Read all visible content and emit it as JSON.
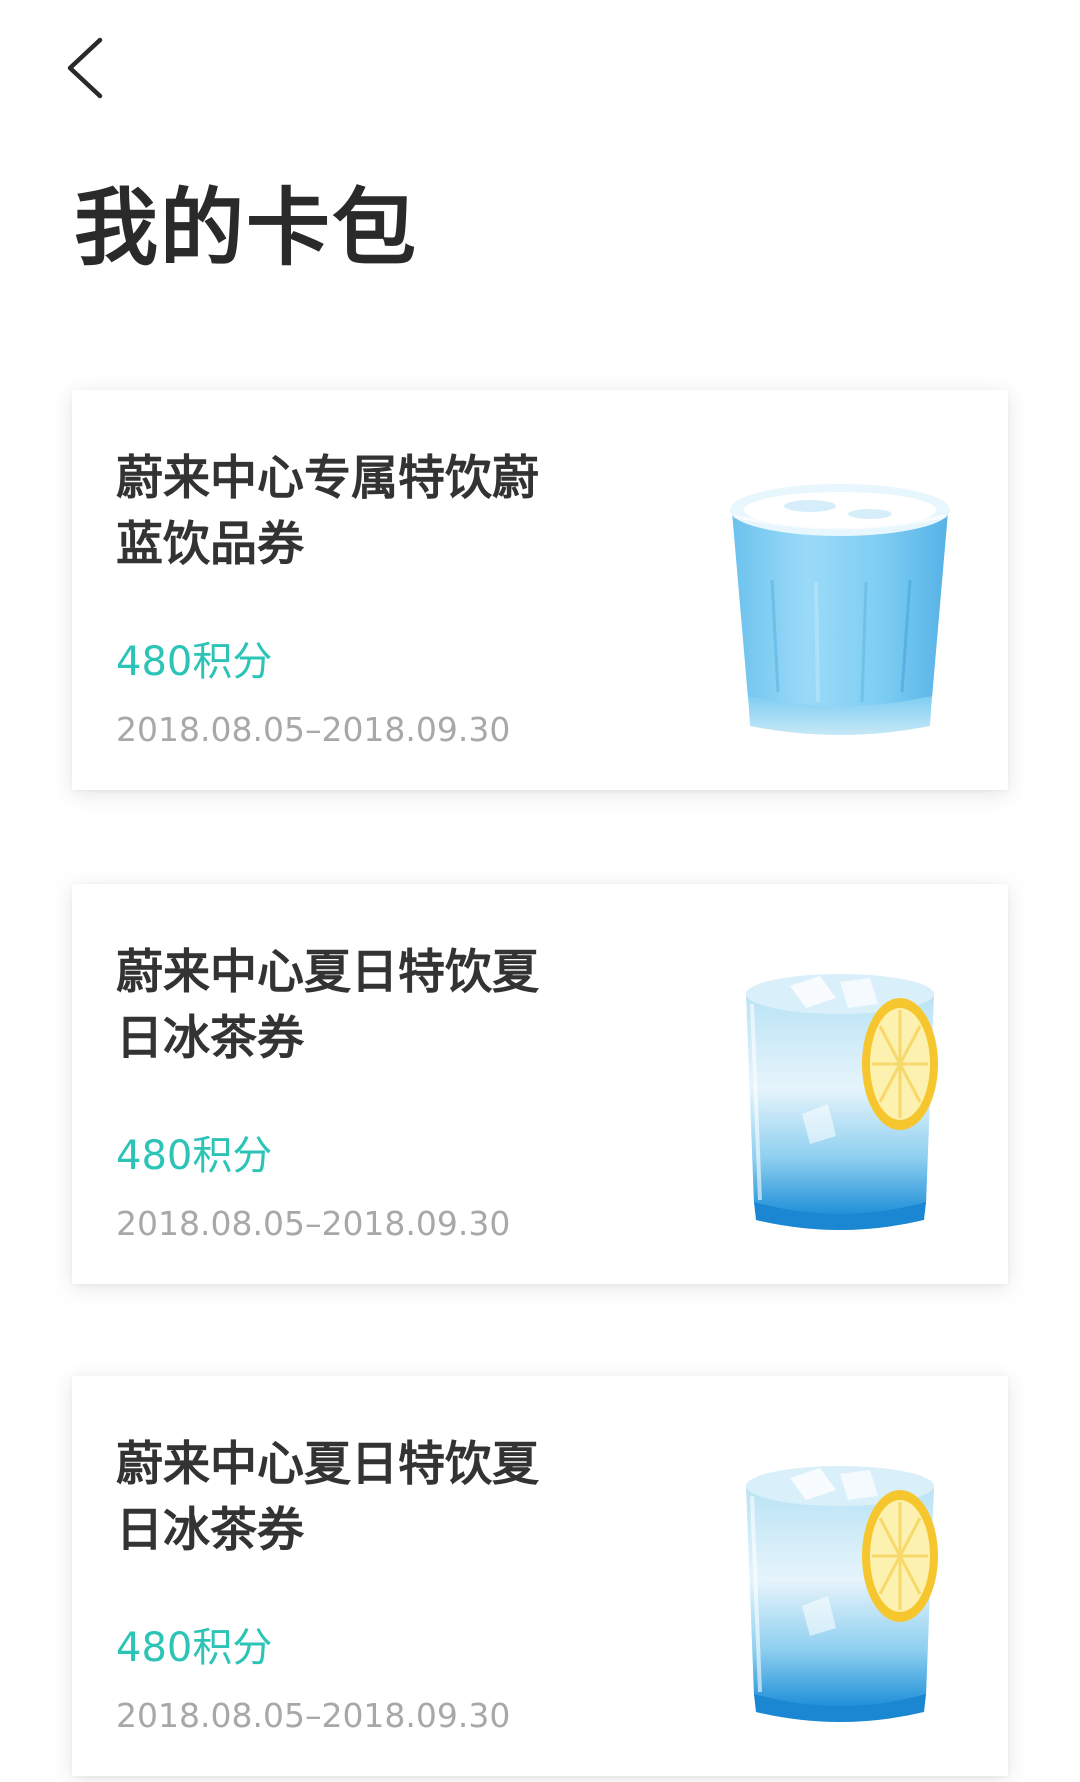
{
  "header": {
    "back_icon": "chevron-left-icon",
    "title": "我的卡包"
  },
  "cards": [
    {
      "name": "蔚来中心专属特饮蔚蓝饮品券",
      "points": "480积分",
      "dates": "2018.08.05–2018.09.30",
      "image": "blue-latte-glass"
    },
    {
      "name": "蔚来中心夏日特饮夏日冰茶券",
      "points": "480积分",
      "dates": "2018.08.05–2018.09.30",
      "image": "iced-tea-lemon-glass"
    },
    {
      "name": "蔚来中心夏日特饮夏日冰茶券",
      "points": "480积分",
      "dates": "2018.08.05–2018.09.30",
      "image": "iced-tea-lemon-glass"
    }
  ],
  "colors": {
    "points_accent": "#2cc4b6",
    "date_text": "#a8a8a8",
    "title_text": "#2a2a2a"
  }
}
